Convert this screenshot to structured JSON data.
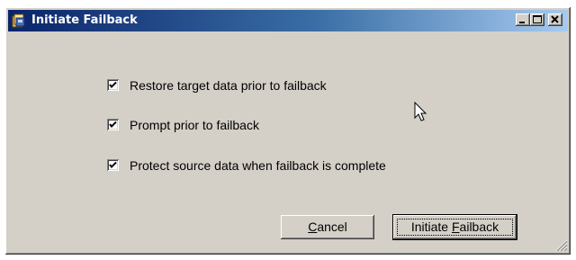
{
  "window": {
    "title": "Initiate Failback",
    "title_icon": "application-icon"
  },
  "titlebar_buttons": [
    "minimize-icon",
    "maximize-icon",
    "close-icon"
  ],
  "options": [
    {
      "label": "Restore target data prior to failback",
      "checked": true
    },
    {
      "label": "Prompt prior to failback",
      "checked": true
    },
    {
      "label": "Protect source data when failback is complete",
      "checked": true
    }
  ],
  "buttons": {
    "cancel": {
      "mnemonic": "C",
      "rest": "ancel"
    },
    "initiate": {
      "prefix": "Initiate ",
      "mnemonic": "F",
      "rest": "ailback"
    }
  },
  "colors": {
    "titlebar_start": "#0a246a",
    "titlebar_end": "#a6caf0",
    "face": "#d4d0c8"
  }
}
